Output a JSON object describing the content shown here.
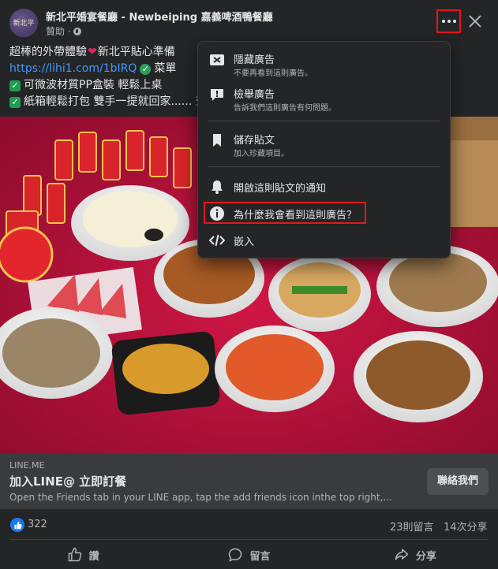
{
  "post": {
    "page_name": "新北平婚宴餐廳 - Newbeiping 嘉義啤酒鴨餐廳",
    "avatar_text": "新北平",
    "sponsored": "贊助 ·",
    "text_line1": "超棒的外帶體驗",
    "text_line1b": "新北平貼心準備",
    "link_url": "https://lihi1.com/1bIRQ",
    "link_suffix": "菜單",
    "bullet1": "可微波材質PP盒裝 輕鬆上桌",
    "bullet2": "紙箱輕鬆打包 雙手一提就回家...... 查"
  },
  "link_card": {
    "domain": "LINE.ME",
    "title": "加入LINE@ 立即訂餐",
    "description": "Open the Friends tab in your LINE app, tap the add friends icon inthe top right,...",
    "cta_label": "聯絡我們"
  },
  "engagement": {
    "reactions": "322",
    "comments": "23則留言",
    "shares": "14次分享"
  },
  "actions": {
    "like": "讚",
    "comment": "留言",
    "share": "分享"
  },
  "menu": {
    "hide_title": "隱藏廣告",
    "hide_sub": "不要再看到這則廣告。",
    "report_title": "檢舉廣告",
    "report_sub": "告訴我們這則廣告有何問題。",
    "save_title": "儲存貼文",
    "save_sub": "加入珍藏項目。",
    "notify_title": "開啟這則貼文的通知",
    "why_title": "為什麼我會看到這則廣告？",
    "embed_title": "嵌入"
  },
  "colors": {
    "background": "#242526",
    "card": "#3a3b3c",
    "link": "#4599ff",
    "highlight": "#e0191e",
    "like_blue": "#1877f2"
  }
}
